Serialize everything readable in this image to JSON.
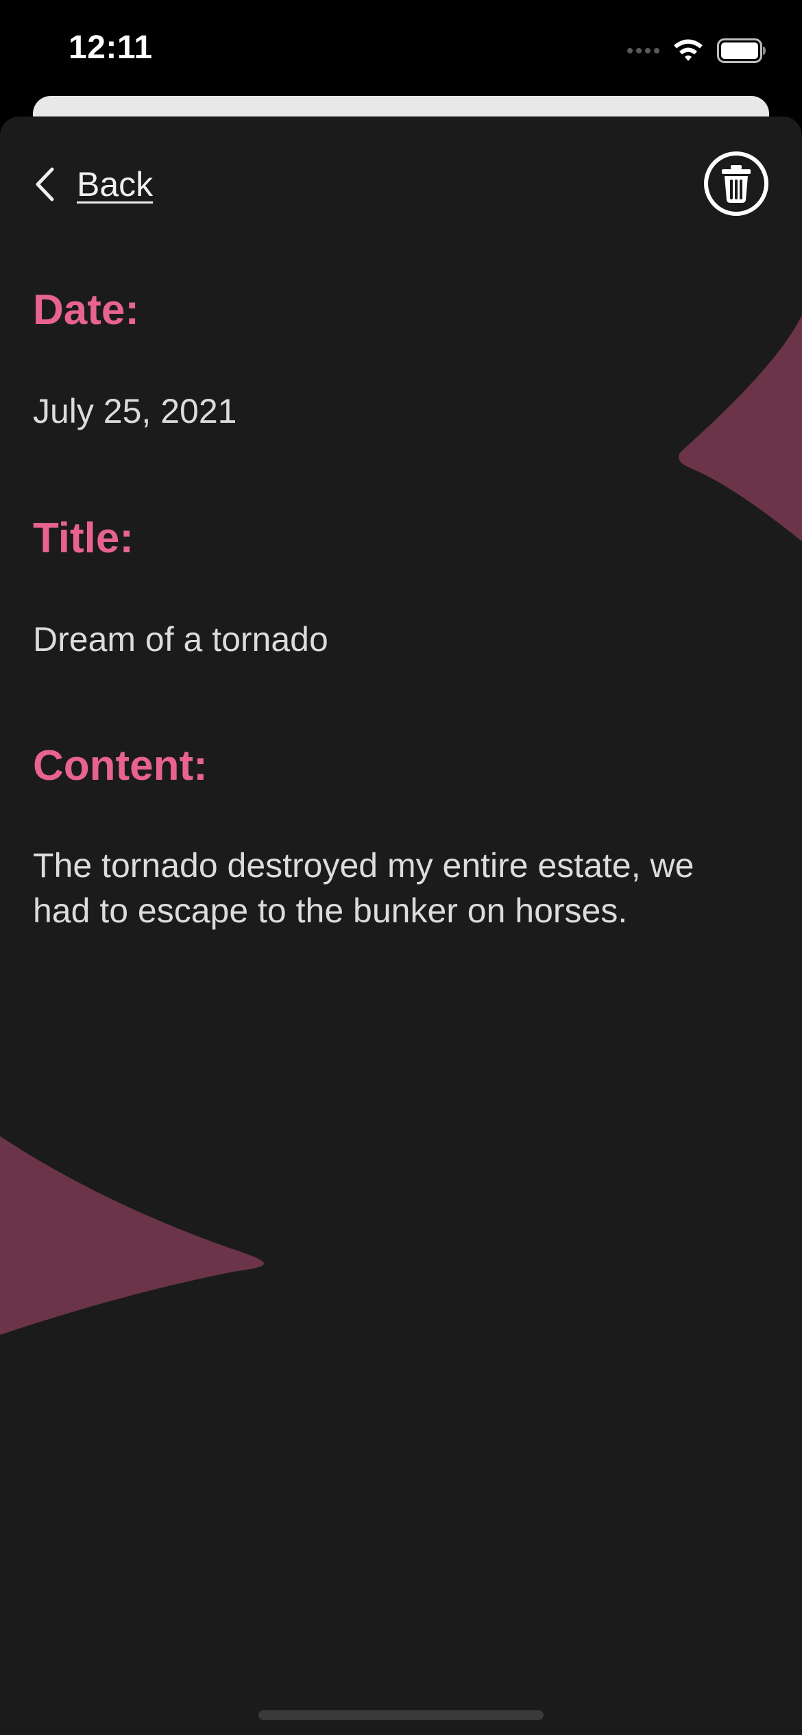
{
  "status_bar": {
    "time": "12:11"
  },
  "nav": {
    "back_label": "Back"
  },
  "entry": {
    "date_label": "Date:",
    "date_value": "July 25, 2021",
    "title_label": "Title:",
    "title_value": "Dream of a tornado",
    "content_label": "Content:",
    "content_value": "The tornado destroyed my entire estate, we had to escape to the bunker on horses."
  },
  "icons": {
    "back": "chevron-left-icon",
    "delete": "trash-icon",
    "wifi": "wifi-icon",
    "battery": "battery-icon",
    "signal": "cellular-signal-icon"
  },
  "colors": {
    "accent": "#e8638f",
    "decoration": "#6b3449",
    "sheet_background": "#1b1b1b",
    "text": "#dcdcdc"
  }
}
